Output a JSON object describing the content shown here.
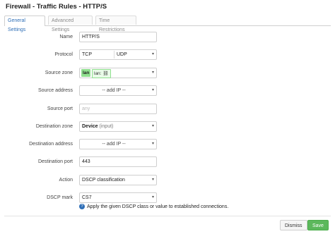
{
  "dialog": {
    "title": "Firewall - Traffic Rules - HTTP/S"
  },
  "tabs": [
    {
      "label": "General Settings"
    },
    {
      "label": "Advanced Settings"
    },
    {
      "label": "Time Restrictions"
    }
  ],
  "fields": {
    "name": {
      "label": "Name",
      "value": "HTTP/S"
    },
    "protocol": {
      "label": "Protocol",
      "values": [
        "TCP",
        "UDP"
      ]
    },
    "source_zone": {
      "label": "Source zone",
      "badge": "lan",
      "badge_text": "lan:"
    },
    "source_address": {
      "label": "Source address",
      "placeholder": "-- add IP --"
    },
    "source_port": {
      "label": "Source port",
      "placeholder": "any"
    },
    "destination_zone": {
      "label": "Destination zone",
      "value": "Device",
      "suffix": "(input)"
    },
    "destination_address": {
      "label": "Destination address",
      "placeholder": "-- add IP --"
    },
    "destination_port": {
      "label": "Destination port",
      "value": "443"
    },
    "action": {
      "label": "Action",
      "value": "DSCP classification"
    },
    "dscp_mark": {
      "label": "DSCP mark",
      "value": "CS7",
      "help": "Apply the given DSCP class or value to established connections."
    }
  },
  "footer": {
    "dismiss_label": "Dismiss",
    "save_label": "Save"
  },
  "colors": {
    "accent": "#2f6fb7",
    "save": "#5cb85c",
    "zone_lan": "#90e08f"
  }
}
